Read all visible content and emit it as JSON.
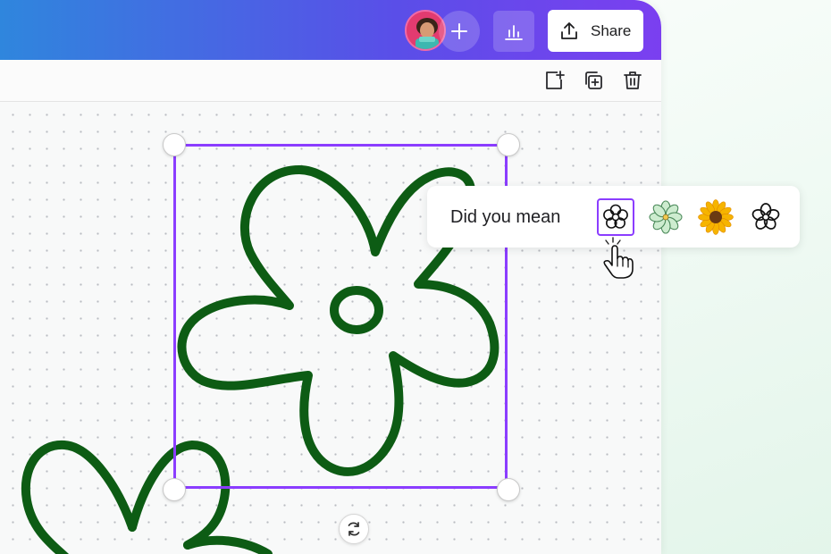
{
  "header": {
    "share_label": "Share",
    "avatar_icon": "user-avatar",
    "add_icon": "plus-icon",
    "analytics_icon": "bar-chart-icon",
    "share_icon": "upload-icon"
  },
  "page_toolbar": {
    "icons": [
      "add-page-icon",
      "duplicate-page-icon",
      "trash-icon"
    ]
  },
  "suggestions": {
    "label": "Did you mean",
    "items": [
      "outline-flower",
      "mint-flower",
      "sunflower",
      "outline-flower-alt"
    ],
    "selected_index": 0
  },
  "canvas": {
    "element_color": "#0d5c14",
    "selection_color": "#8b3dff",
    "rotate_icon": "rotate-icon"
  },
  "colors": {
    "accent": "#8b3dff",
    "header_gradient_start": "#2f86dd",
    "header_gradient_end": "#7b3ff0"
  }
}
